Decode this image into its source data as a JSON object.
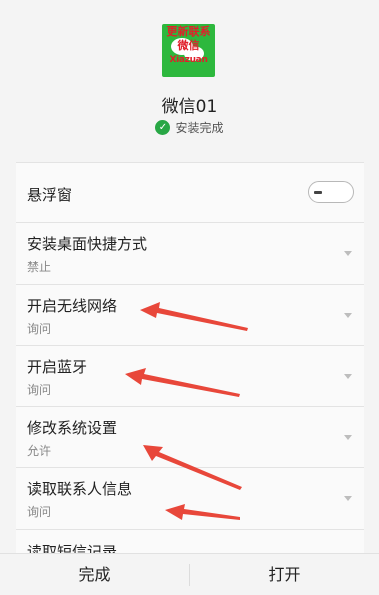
{
  "app": {
    "name": "微信01",
    "status_text": "安装完成",
    "icon_overlay": [
      "更新联系",
      "微信",
      "Xiazuan"
    ]
  },
  "rows": [
    {
      "title": "悬浮窗",
      "control": "toggle",
      "toggle_on": false
    },
    {
      "title": "安装桌面快捷方式",
      "subtitle": "禁止"
    },
    {
      "title": "开启无线网络",
      "subtitle": "询问"
    },
    {
      "title": "开启蓝牙",
      "subtitle": "询问"
    },
    {
      "title": "修改系统设置",
      "subtitle": "允许"
    },
    {
      "title": "读取联系人信息",
      "subtitle": "询问"
    },
    {
      "title": "读取短信记录"
    }
  ],
  "bottom": {
    "done_label": "完成",
    "open_label": "打开"
  },
  "colors": {
    "arrow": "#e8473a",
    "check": "#28a745",
    "icon_green": "#2db83d"
  }
}
